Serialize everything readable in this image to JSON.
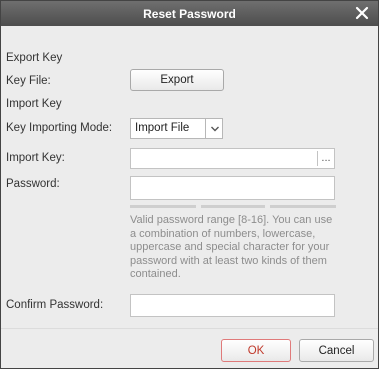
{
  "dialog": {
    "title": "Reset Password",
    "close_icon": "close-icon"
  },
  "export_section": {
    "heading": "Export Key",
    "key_file_label": "Key File:",
    "export_button": "Export"
  },
  "import_section": {
    "heading": "Import Key",
    "mode_label": "Key Importing Mode:",
    "mode_value": "Import File",
    "import_key_label": "Import Key:",
    "import_key_value": "",
    "browse_label": "...",
    "password_label": "Password:",
    "password_value": "",
    "hint": "Valid password range [8-16]. You can use a combination of numbers, lowercase, uppercase and special character for your password with at least two kinds of them contained.",
    "confirm_label": "Confirm Password:",
    "confirm_value": ""
  },
  "footer": {
    "ok_label": "OK",
    "cancel_label": "Cancel"
  },
  "colors": {
    "titlebar": "#5a5a5a",
    "ok_border": "#e07a7a",
    "ok_text": "#c0392b",
    "hint_text": "#8d8d8d"
  }
}
